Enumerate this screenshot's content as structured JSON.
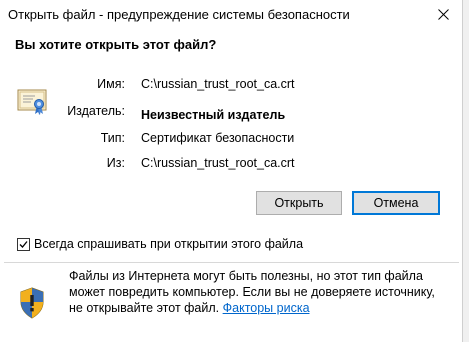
{
  "window": {
    "title": "Открыть файл - предупреждение системы безопасности",
    "close_symbol": "✕"
  },
  "heading": "Вы хотите открыть этот файл?",
  "file_info": {
    "name_label": "Имя:",
    "name_value": "C:\\russian_trust_root_ca.crt",
    "publisher_label": "Издатель:",
    "publisher_value": "Неизвестный издатель",
    "type_label": "Тип:",
    "type_value": "Сертификат безопасности",
    "from_label": "Из:",
    "from_value": "C:\\russian_trust_root_ca.crt"
  },
  "buttons": {
    "open": "Открыть",
    "cancel": "Отмена"
  },
  "checkbox": {
    "label": "Всегда спрашивать при открытии этого файла",
    "checked": true
  },
  "warning": {
    "text": "Файлы из Интернета могут быть полезны, но этот тип файла может повредить компьютер. Если вы не доверяете источнику, не открывайте этот файл.",
    "link": "Факторы риска"
  },
  "icons": {
    "file": "certificate-icon",
    "warning": "security-shield-icon",
    "close": "close-icon"
  },
  "colors": {
    "accent": "#0078d7",
    "link": "#0066cc",
    "button_bg": "#e1e1e1"
  }
}
